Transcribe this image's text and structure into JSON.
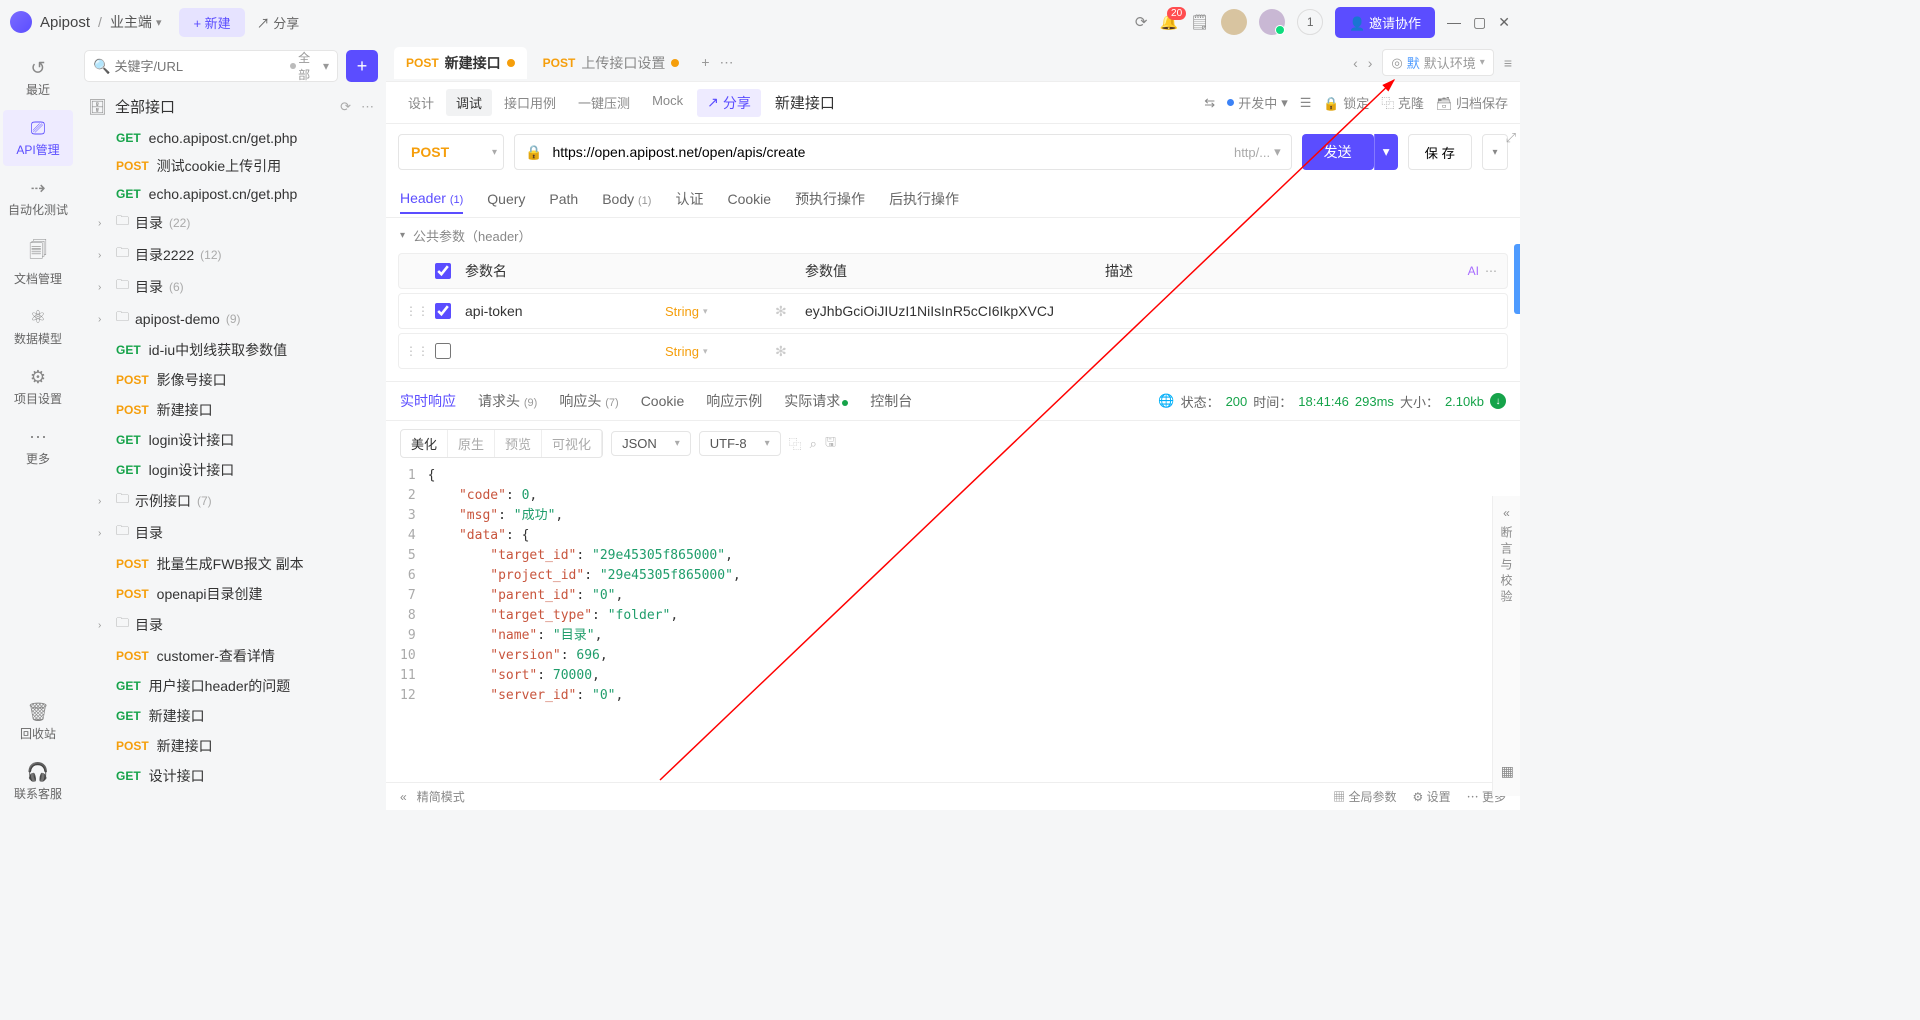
{
  "titlebar": {
    "app": "Apipost",
    "project": "业主端",
    "new": "+  新建",
    "share": "↗  分享",
    "badge": "20",
    "extra_count": "1",
    "invite": "👤  邀请协作"
  },
  "rail": [
    {
      "icon": "↺",
      "label": "最近"
    },
    {
      "icon": "⎚",
      "label": "API管理",
      "active": true
    },
    {
      "icon": "⇢",
      "label": "自动化测试"
    },
    {
      "icon": "🗐",
      "label": "文档管理"
    },
    {
      "icon": "⚛",
      "label": "数据模型"
    },
    {
      "icon": "⚙",
      "label": "项目设置"
    },
    {
      "icon": "⋯",
      "label": "更多"
    }
  ],
  "rail_bottom": [
    {
      "icon": "🗑",
      "label": "回收站"
    },
    {
      "icon": "🎧",
      "label": "联系客服"
    }
  ],
  "search": {
    "placeholder": "关键字/URL",
    "filter": "全部"
  },
  "all_apis": "全部接口",
  "tree": [
    {
      "type": "api",
      "method": "GET",
      "name": "echo.apipost.cn/get.php"
    },
    {
      "type": "api",
      "method": "POST",
      "name": "测试cookie上传引用"
    },
    {
      "type": "api",
      "method": "GET",
      "name": "echo.apipost.cn/get.php"
    },
    {
      "type": "folder",
      "name": "目录",
      "count": "(22)"
    },
    {
      "type": "folder",
      "name": "目录2222",
      "count": "(12)"
    },
    {
      "type": "folder",
      "name": "目录",
      "count": "(6)"
    },
    {
      "type": "folder",
      "name": "apipost-demo",
      "count": "(9)"
    },
    {
      "type": "api",
      "method": "GET",
      "name": "id-iu中划线获取参数值"
    },
    {
      "type": "api",
      "method": "POST",
      "name": "影像号接口"
    },
    {
      "type": "api",
      "method": "POST",
      "name": "新建接口"
    },
    {
      "type": "api",
      "method": "GET",
      "name": "login设计接口"
    },
    {
      "type": "api",
      "method": "GET",
      "name": "login设计接口"
    },
    {
      "type": "folder",
      "name": "示例接口",
      "count": "(7)"
    },
    {
      "type": "folder",
      "name": "目录",
      "count": ""
    },
    {
      "type": "api",
      "method": "POST",
      "name": "批量生成FWB报文 副本"
    },
    {
      "type": "api",
      "method": "POST",
      "name": "openapi目录创建"
    },
    {
      "type": "folder",
      "name": "目录",
      "count": ""
    },
    {
      "type": "api",
      "method": "POST",
      "name": "customer-查看详情"
    },
    {
      "type": "api",
      "method": "GET",
      "name": "用户接口header的问题"
    },
    {
      "type": "api",
      "method": "GET",
      "name": "新建接口"
    },
    {
      "type": "api",
      "method": "POST",
      "name": "新建接口"
    },
    {
      "type": "api",
      "method": "GET",
      "name": "设计接口"
    }
  ],
  "tabs": [
    {
      "method": "POST",
      "title": "新建接口",
      "dirty": true,
      "active": true
    },
    {
      "method": "POST",
      "title": "上传接口设置",
      "dirty": true,
      "active": false
    }
  ],
  "env": {
    "prefix": "默",
    "name": "默认环境"
  },
  "subbar": {
    "segs": [
      "设计",
      "调试",
      "接口用例",
      "一键压测",
      "Mock"
    ],
    "active": 1,
    "share": "分享",
    "title": "新建接口",
    "status": "开发中",
    "lock": "锁定",
    "clone": "克隆",
    "archive": "归档保存"
  },
  "request": {
    "method": "POST",
    "url": "https://open.apipost.net/open/apis/create",
    "proto": "http/...",
    "send": "发送",
    "save": "保 存"
  },
  "ptabs": [
    {
      "label": "Header",
      "count": "(1)",
      "active": true
    },
    {
      "label": "Query"
    },
    {
      "label": "Path"
    },
    {
      "label": "Body",
      "count": "(1)"
    },
    {
      "label": "认证"
    },
    {
      "label": "Cookie"
    },
    {
      "label": "预执行操作"
    },
    {
      "label": "后执行操作"
    }
  ],
  "public_headers": "公共参数（header）",
  "htable": {
    "cols": {
      "name": "参数名",
      "value": "参数值",
      "desc": "描述"
    },
    "rows": [
      {
        "checked": true,
        "name": "api-token",
        "type": "String",
        "value": "eyJhbGciOiJIUzI1NiIsInR5cCI6IkpXVCJ"
      },
      {
        "checked": false,
        "name": "",
        "type": "String",
        "value": ""
      }
    ]
  },
  "resp_tabs": [
    {
      "label": "实时响应",
      "active": true
    },
    {
      "label": "请求头",
      "count": "(9)"
    },
    {
      "label": "响应头",
      "count": "(7)"
    },
    {
      "label": "Cookie"
    },
    {
      "label": "响应示例"
    },
    {
      "label": "实际请求",
      "dot": true
    },
    {
      "label": "控制台"
    }
  ],
  "resp_meta": {
    "status_k": "状态：",
    "status_v": "200",
    "time_k": "时间：",
    "time_v1": "18:41:46",
    "time_v2": "293ms",
    "size_k": "大小：",
    "size_v": "2.10kb"
  },
  "resp_toolbar": {
    "fmts": [
      "美化",
      "原生",
      "预览",
      "可视化"
    ],
    "fmt_active": 0,
    "type": "JSON",
    "enc": "UTF-8"
  },
  "code_lines": [
    "{",
    "    \"code\": 0,",
    "    \"msg\": \"成功\",",
    "    \"data\": {",
    "        \"target_id\": \"29e45305f865000\",",
    "        \"project_id\": \"29e45305f865000\",",
    "        \"parent_id\": \"0\",",
    "        \"target_type\": \"folder\",",
    "        \"name\": \"目录\",",
    "        \"version\": 696,",
    "        \"sort\": 70000,",
    "        \"server_id\": \"0\","
  ],
  "right_panel": {
    "chevron": "«",
    "label": "断言与校验"
  },
  "footer": {
    "mode": "精简模式",
    "global": "全局参数",
    "settings": "设置",
    "more": "更多"
  }
}
